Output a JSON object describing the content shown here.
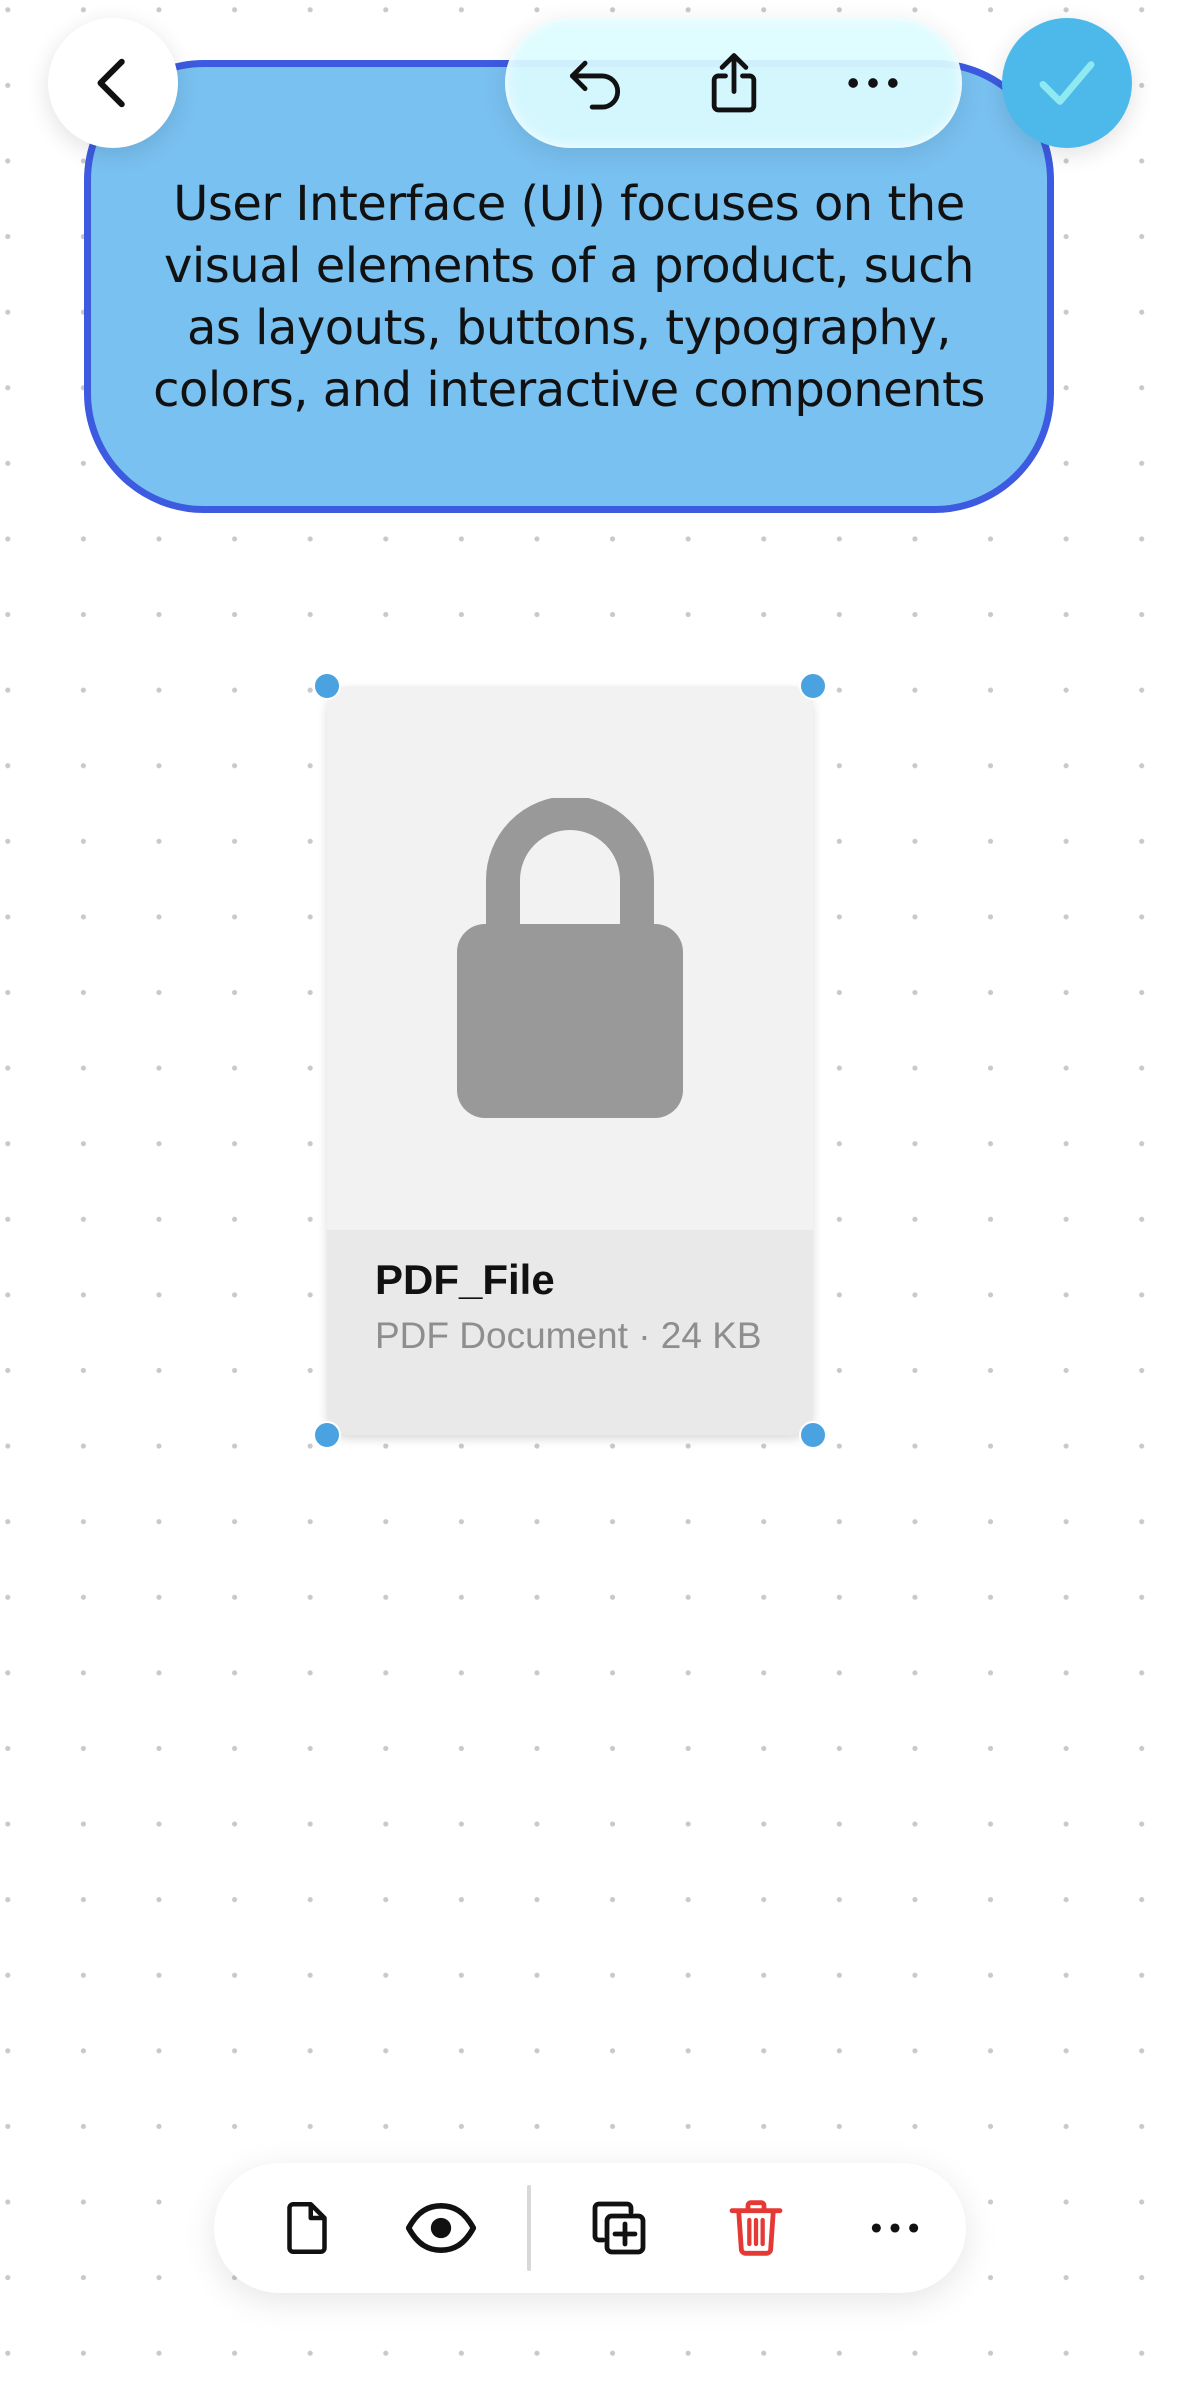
{
  "note": {
    "text": "User Interface (UI) focuses on the visual elements of a product, such as layouts, buttons, typography, colors, and interactive components",
    "fill_color": "#79c1f1",
    "border_color": "#3d5be0"
  },
  "top_bar": {
    "back_icon": "chevron-left-icon",
    "undo_icon": "undo-icon",
    "share_icon": "share-icon",
    "more_icon": "more-horizontal-icon",
    "done_icon": "checkmark-icon",
    "done_color": "#4cb9ea"
  },
  "file_card": {
    "name": "PDF_File",
    "meta": "PDF Document · 24 KB",
    "preview_icon": "lock-icon",
    "selection_color": "#4aa3e0"
  },
  "bottom_toolbar": {
    "items": [
      {
        "icon": "document-icon"
      },
      {
        "icon": "eye-icon"
      },
      {
        "icon": "duplicate-icon"
      },
      {
        "icon": "trash-icon",
        "color": "#e53935"
      },
      {
        "icon": "more-horizontal-icon"
      }
    ]
  }
}
